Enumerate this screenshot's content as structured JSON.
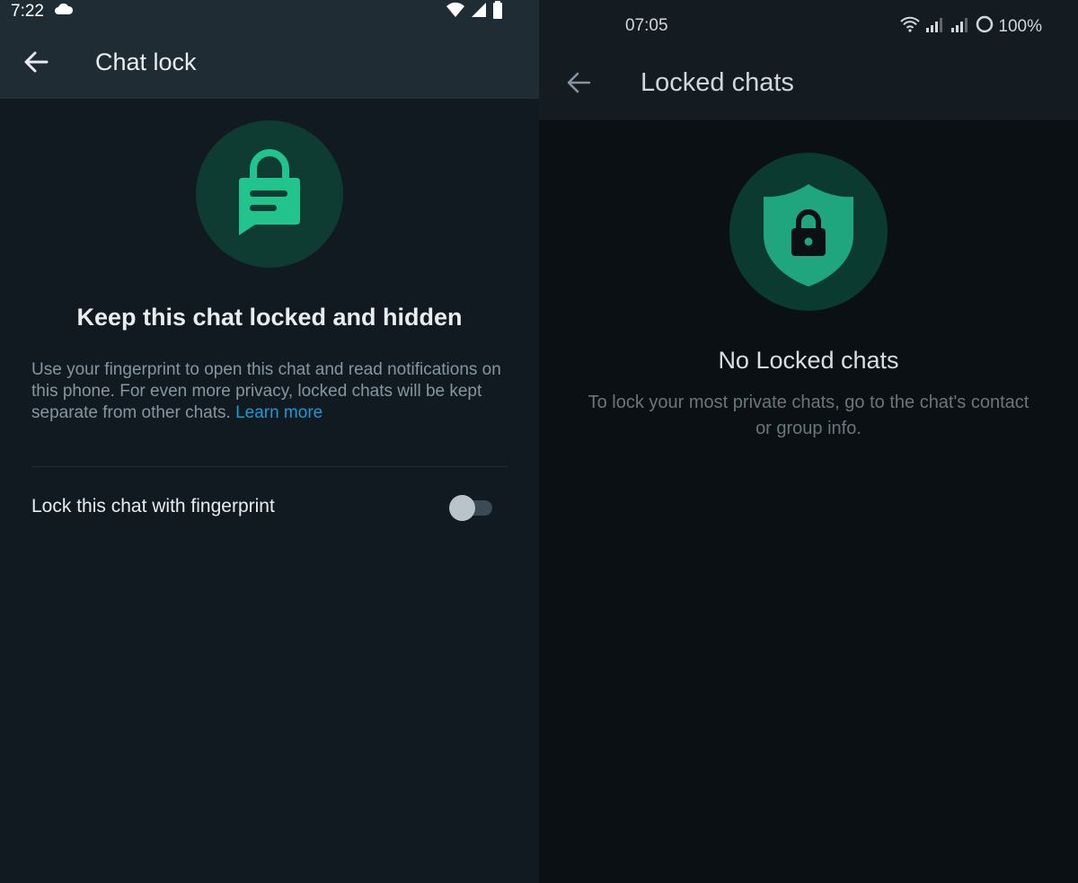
{
  "left_screen": {
    "status_bar": {
      "time": "7:22"
    },
    "app_bar": {
      "title": "Chat lock"
    },
    "hero": {
      "icon": "chat-lock-icon"
    },
    "heading": "Keep this chat locked and hidden",
    "description": "Use your fingerprint to open this chat and read notifications on this phone. For even more privacy, locked chats will be kept separate from other chats.",
    "learn_more_link": "Learn more",
    "setting": {
      "label": "Lock this chat with fingerprint",
      "enabled": false
    }
  },
  "right_screen": {
    "status_bar": {
      "time": "07:05",
      "battery": "100%"
    },
    "app_bar": {
      "title": "Locked chats"
    },
    "hero": {
      "icon": "shield-lock-icon"
    },
    "heading": "No Locked chats",
    "description": "To lock your most private chats, go to the chat's contact or group info."
  },
  "colors": {
    "accent": "#21c48c",
    "link": "#1b9bd1",
    "background_left": "#121a21",
    "background_right": "#0b1014"
  }
}
